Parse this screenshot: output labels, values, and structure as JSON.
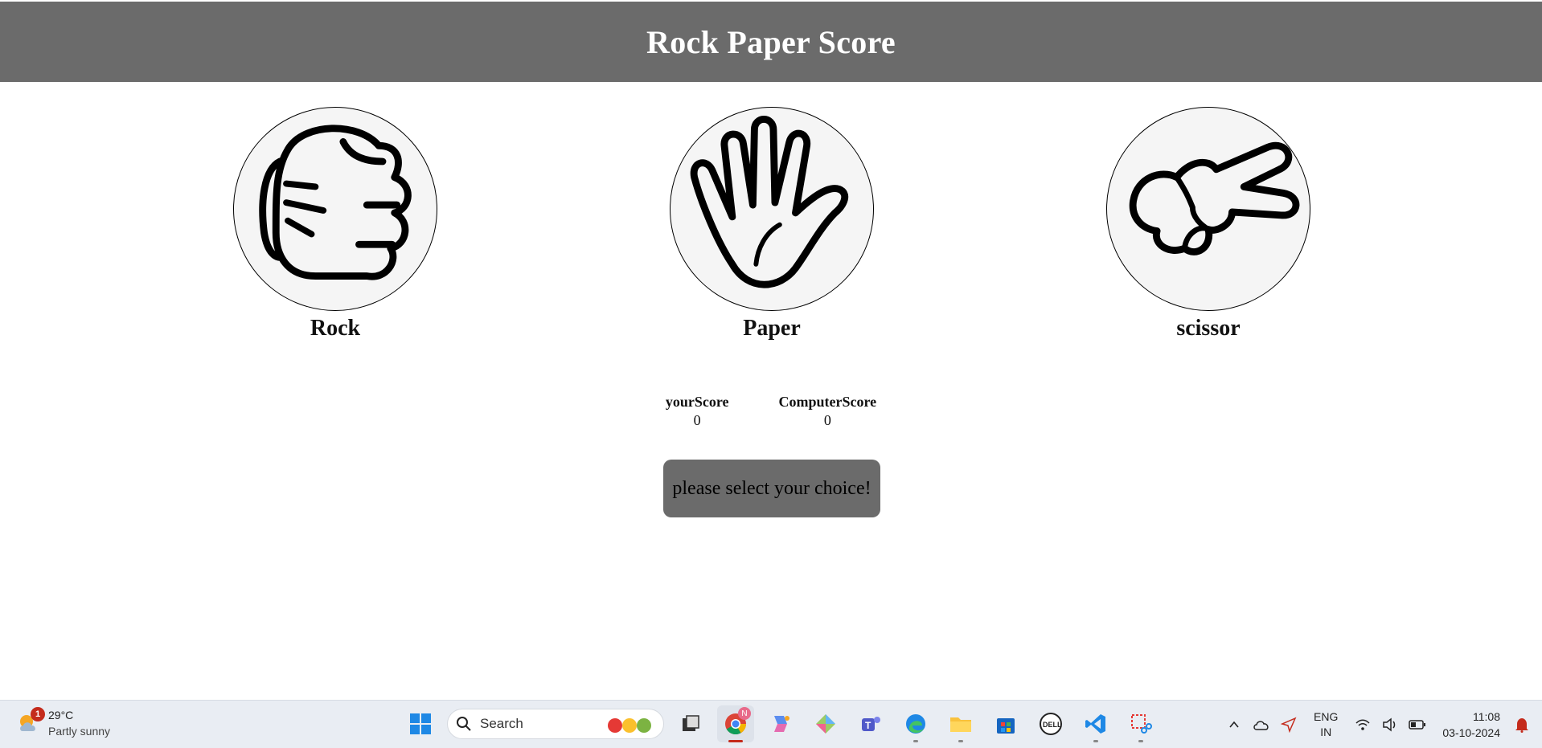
{
  "header": {
    "title": "Rock Paper Score"
  },
  "choices": [
    {
      "label": "Rock",
      "icon": "rock-fist-icon"
    },
    {
      "label": "Paper",
      "icon": "paper-hand-icon"
    },
    {
      "label": "scissor",
      "icon": "scissor-hand-icon"
    }
  ],
  "scores": {
    "user_title": "yourScore",
    "user_value": "0",
    "computer_title": "ComputerScore",
    "computer_value": "0"
  },
  "message": "please select your choice!",
  "taskbar": {
    "weather": {
      "temp": "29°C",
      "condition": "Partly sunny",
      "badge": "1"
    },
    "search_placeholder": "Search",
    "chrome_badge": "N",
    "lang_top": "ENG",
    "lang_bottom": "IN",
    "time": "11:08",
    "date": "03-10-2024",
    "colors": {
      "header_bg": "#6b6b6b",
      "message_bg": "#6b6b6b",
      "taskbar_bg": "#e9edf3"
    }
  }
}
